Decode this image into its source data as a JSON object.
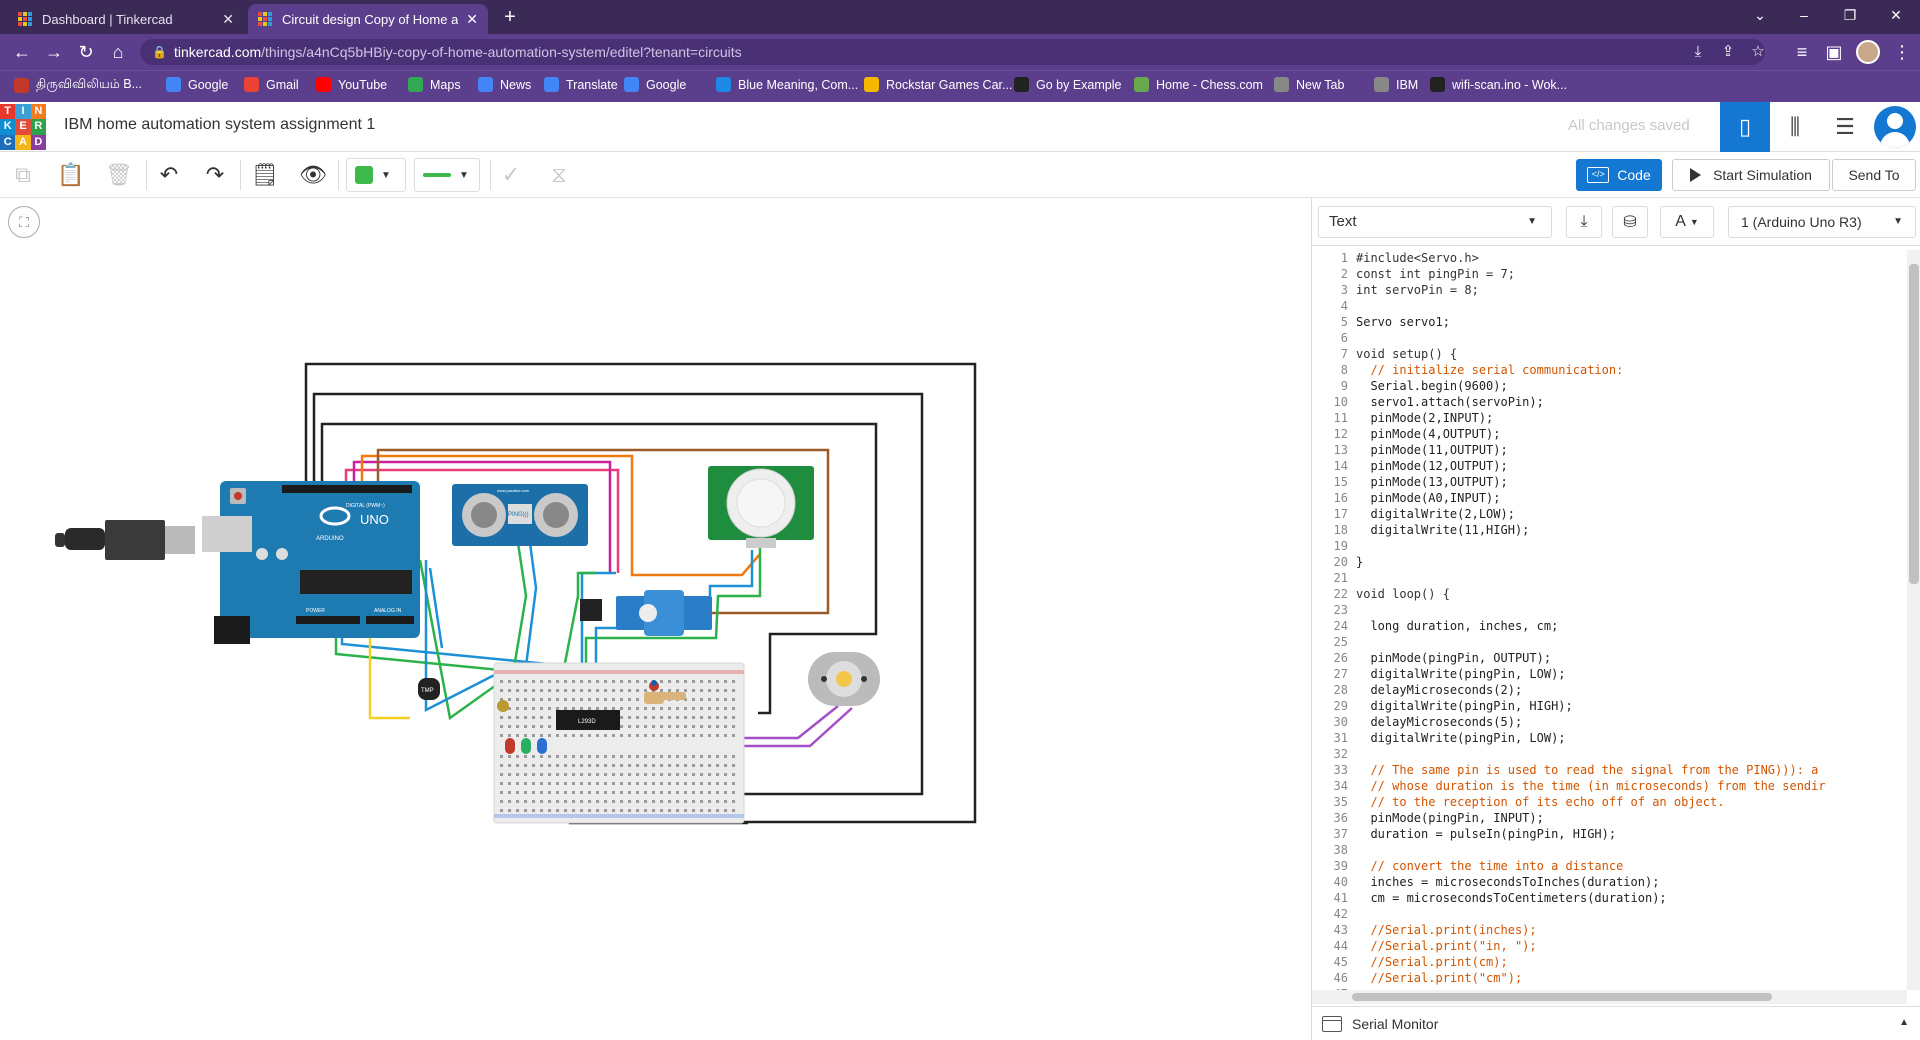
{
  "browser": {
    "tabs": [
      {
        "title": "Dashboard | Tinkercad",
        "active": false
      },
      {
        "title": "Circuit design Copy of Home aut",
        "active": true
      }
    ],
    "new_tab": "+",
    "address": {
      "host": "tinkercad.com",
      "path": "/things/a4nCq5bHBiy-copy-of-home-automation-system/editel?tenant=circuits"
    },
    "bookmarks": [
      {
        "label": "திருவிவிலியம் B...",
        "icon": "bible-icon",
        "color": "#c0392b"
      },
      {
        "label": "Google",
        "icon": "google-icon",
        "color": "#4285f4"
      },
      {
        "label": "Gmail",
        "icon": "gmail-icon",
        "color": "#ea4335"
      },
      {
        "label": "YouTube",
        "icon": "youtube-icon",
        "color": "#ff0000"
      },
      {
        "label": "Maps",
        "icon": "maps-icon",
        "color": "#34a853"
      },
      {
        "label": "News",
        "icon": "news-icon",
        "color": "#4285f4"
      },
      {
        "label": "Translate",
        "icon": "translate-icon",
        "color": "#4285f4"
      },
      {
        "label": "Google",
        "icon": "google-icon",
        "color": "#4285f4"
      },
      {
        "label": "Blue Meaning, Com...",
        "icon": "globe-icon",
        "color": "#1e88e5"
      },
      {
        "label": "Rockstar Games Car...",
        "icon": "rockstar-icon",
        "color": "#f5b800"
      },
      {
        "label": "Go by Example",
        "icon": "code-icon",
        "color": "#222"
      },
      {
        "label": "Home - Chess.com",
        "icon": "chess-icon",
        "color": "#6aa84f"
      },
      {
        "label": "New Tab",
        "icon": "globe-icon",
        "color": "#888"
      },
      {
        "label": "IBM",
        "icon": "globe-icon",
        "color": "#888"
      },
      {
        "label": "wifi-scan.ino - Wok...",
        "icon": "wokwi-icon",
        "color": "#222"
      }
    ]
  },
  "app": {
    "logo_letters": [
      "T",
      "I",
      "N",
      "K",
      "E",
      "R",
      "C",
      "A",
      "D"
    ],
    "title": "IBM home automation system assignment 1",
    "save_status": "All changes saved",
    "buttons": {
      "code": "Code",
      "simulate": "Start Simulation",
      "send": "Send To"
    }
  },
  "code_panel": {
    "mode": "Text",
    "board": "1 (Arduino Uno R3)",
    "serial_monitor": "Serial Monitor",
    "lines": [
      {
        "n": "1",
        "t": "#include<Servo.h>",
        "k": "kw"
      },
      {
        "n": "2",
        "t": "const int pingPin = 7;",
        "k": "kw"
      },
      {
        "n": "3",
        "t": "int servoPin = 8;",
        "k": "kw"
      },
      {
        "n": "4",
        "t": "",
        "k": ""
      },
      {
        "n": "5",
        "t": "Servo servo1;",
        "k": ""
      },
      {
        "n": "6",
        "t": "",
        "k": ""
      },
      {
        "n": "7",
        "t": "void setup() {",
        "k": "kw"
      },
      {
        "n": "8",
        "t": "  // initialize serial communication:",
        "k": "comment"
      },
      {
        "n": "9",
        "t": "  Serial.begin(9600);",
        "k": ""
      },
      {
        "n": "10",
        "t": "  servo1.attach(servoPin);",
        "k": ""
      },
      {
        "n": "11",
        "t": "  pinMode(2,INPUT);",
        "k": ""
      },
      {
        "n": "12",
        "t": "  pinMode(4,OUTPUT);",
        "k": ""
      },
      {
        "n": "13",
        "t": "  pinMode(11,OUTPUT);",
        "k": ""
      },
      {
        "n": "14",
        "t": "  pinMode(12,OUTPUT);",
        "k": ""
      },
      {
        "n": "15",
        "t": "  pinMode(13,OUTPUT);",
        "k": ""
      },
      {
        "n": "16",
        "t": "  pinMode(A0,INPUT);",
        "k": ""
      },
      {
        "n": "17",
        "t": "  digitalWrite(2,LOW);",
        "k": ""
      },
      {
        "n": "18",
        "t": "  digitalWrite(11,HIGH);",
        "k": ""
      },
      {
        "n": "19",
        "t": "",
        "k": ""
      },
      {
        "n": "20",
        "t": "}",
        "k": ""
      },
      {
        "n": "21",
        "t": "",
        "k": ""
      },
      {
        "n": "22",
        "t": "void loop() {",
        "k": "kw"
      },
      {
        "n": "23",
        "t": "",
        "k": ""
      },
      {
        "n": "24",
        "t": "  long duration, inches, cm;",
        "k": ""
      },
      {
        "n": "25",
        "t": "",
        "k": ""
      },
      {
        "n": "26",
        "t": "  pinMode(pingPin, OUTPUT);",
        "k": ""
      },
      {
        "n": "27",
        "t": "  digitalWrite(pingPin, LOW);",
        "k": ""
      },
      {
        "n": "28",
        "t": "  delayMicroseconds(2);",
        "k": ""
      },
      {
        "n": "29",
        "t": "  digitalWrite(pingPin, HIGH);",
        "k": ""
      },
      {
        "n": "30",
        "t": "  delayMicroseconds(5);",
        "k": ""
      },
      {
        "n": "31",
        "t": "  digitalWrite(pingPin, LOW);",
        "k": ""
      },
      {
        "n": "32",
        "t": "",
        "k": ""
      },
      {
        "n": "33",
        "t": "  // The same pin is used to read the signal from the PING))): a",
        "k": "comment"
      },
      {
        "n": "34",
        "t": "  // whose duration is the time (in microseconds) from the sendir",
        "k": "comment"
      },
      {
        "n": "35",
        "t": "  // to the reception of its echo off of an object.",
        "k": "comment"
      },
      {
        "n": "36",
        "t": "  pinMode(pingPin, INPUT);",
        "k": ""
      },
      {
        "n": "37",
        "t": "  duration = pulseIn(pingPin, HIGH);",
        "k": ""
      },
      {
        "n": "38",
        "t": "",
        "k": ""
      },
      {
        "n": "39",
        "t": "  // convert the time into a distance",
        "k": "comment"
      },
      {
        "n": "40",
        "t": "  inches = microsecondsToInches(duration);",
        "k": ""
      },
      {
        "n": "41",
        "t": "  cm = microsecondsToCentimeters(duration);",
        "k": ""
      },
      {
        "n": "42",
        "t": "",
        "k": ""
      },
      {
        "n": "43",
        "t": "  //Serial.print(inches);",
        "k": "comment"
      },
      {
        "n": "44",
        "t": "  //Serial.print(\"in, \");",
        "k": "comment"
      },
      {
        "n": "45",
        "t": "  //Serial.print(cm);",
        "k": "comment"
      },
      {
        "n": "46",
        "t": "  //Serial.print(\"cm\");",
        "k": "comment"
      },
      {
        "n": "47",
        "t": "",
        "k": ""
      }
    ]
  },
  "circuit": {
    "arduino": {
      "brand": "ARDUINO",
      "model": "UNO",
      "digital_label": "DIGITAL (PWM~)",
      "power_label": "POWER",
      "analog_label": "ANALOG IN"
    },
    "ultrasonic_label": "PING)))",
    "ultrasonic_site": "www.parallax.com",
    "driver_label": "L293D",
    "sensor_label": "TMP"
  },
  "colors": {
    "accent": "#1477d1",
    "chrome_tab": "#5c3f8c",
    "chrome_frame": "#3a2a55"
  }
}
